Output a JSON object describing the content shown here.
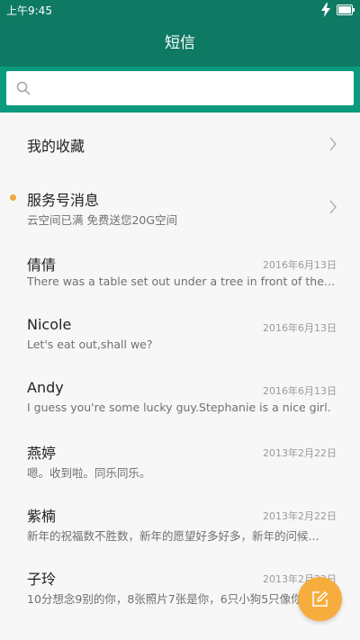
{
  "status_bar": {
    "time": "上午9:45"
  },
  "header": {
    "title": "短信"
  },
  "search": {
    "placeholder": ""
  },
  "colors": {
    "primary": "#0f7a63",
    "search_band": "#0b9a7d",
    "fab": "#f7ad3d",
    "unread_dot": "#f2a83b"
  },
  "conversations": [
    {
      "name": "我的收藏",
      "preview": "",
      "date": ""
    },
    {
      "name": "服务号消息",
      "preview": "云空间已满 免费送您20G空间",
      "date": ""
    },
    {
      "name": "倩倩",
      "preview": "There was a table set out under a tree in front of the house...",
      "date": "2016年6月13日"
    },
    {
      "name": "Nicole",
      "preview": "Let's eat out,shall we?",
      "date": "2016年6月13日"
    },
    {
      "name": "Andy",
      "preview": "I guess you're some lucky guy.Stephanie is a nice girl.",
      "date": "2016年6月13日"
    },
    {
      "name": "燕婷",
      "preview": "嗯。收到啦。同乐同乐。",
      "date": "2013年2月22日"
    },
    {
      "name": "紫楠",
      "preview": "新年的祝福数不胜数，新年的愿望好多好多，新年的问候...",
      "date": "2013年2月22日"
    },
    {
      "name": "子玲",
      "preview": "10分想念9别的你，8张照片7张是你，6只小狗5只像你...",
      "date": "2013年2月22日"
    }
  ],
  "icons": {
    "search": "search-icon",
    "compose": "compose-icon",
    "chevron": "chevron-right-icon",
    "battery": "battery-icon",
    "charging": "charging-icon"
  }
}
